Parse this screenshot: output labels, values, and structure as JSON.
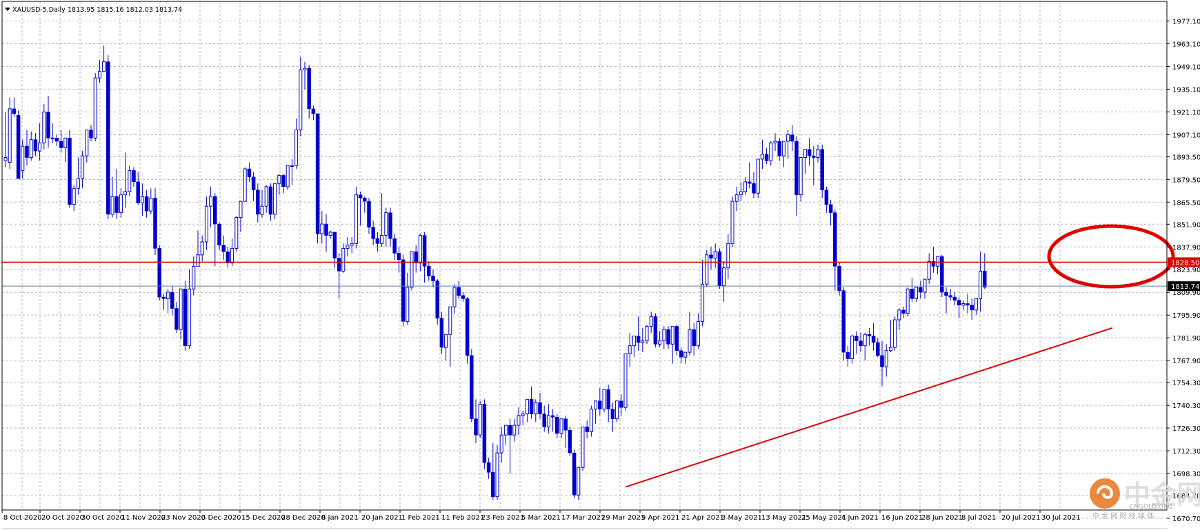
{
  "header": {
    "symbol": "XAUUSD-5,Daily",
    "ohlc": "1813.95 1815.16 1812.03 1813.74"
  },
  "price_labels": {
    "resistance": "1828.50",
    "current": "1813.74"
  },
  "watermark": {
    "brand": "中金网",
    "site": "CNGOLD.ORG",
    "tagline": "中 金 网 财 经 媒 体"
  },
  "colors": {
    "candle": "#0000cc",
    "grid": "#b4b4b4",
    "resistance_line": "#e00000",
    "trend_line": "#e00000",
    "highlight_ellipse": "#e00000",
    "current_price_line": "#5a7fa8",
    "axis_label_resistance_bg": "#e00000",
    "axis_label_current_bg": "#000000",
    "watermark_logo": "#e8741c"
  },
  "chart_data": {
    "type": "candlestick",
    "title": "XAUUSD-5,Daily",
    "ylim": [
      1670.7,
      1984.1
    ],
    "y_ticks": [
      "1977.10",
      "1963.10",
      "1949.10",
      "1935.10",
      "1921.10",
      "1907.10",
      "1893.50",
      "1879.50",
      "1865.50",
      "1851.90",
      "1837.90",
      "1823.90",
      "1809.90",
      "1795.90",
      "1781.90",
      "1767.90",
      "1754.30",
      "1740.30",
      "1726.30",
      "1712.30",
      "1698.30",
      "1684.70",
      "1670.70"
    ],
    "x_labels": [
      "8 Oct 2020",
      "20 Oct 2020",
      "30 Oct 2020",
      "11 Nov 2020",
      "23 Nov 2020",
      "3 Dec 2020",
      "15 Dec 2020",
      "28 Dec 2020",
      "8 Jan 2021",
      "20 Jan 2021",
      "1 Feb 2021",
      "11 Feb 2021",
      "23 Feb 2021",
      "5 Mar 2021",
      "17 Mar 2021",
      "29 Mar 2021",
      "9 Apr 2021",
      "21 Apr 2021",
      "3 May 2021",
      "13 May 2021",
      "25 May 2021",
      "4 Jun 2021",
      "16 Jun 2021",
      "28 Jun 2021",
      "8 Jul 2021",
      "20 Jul 2021",
      "30 Jul 2021"
    ],
    "grid": true,
    "resistance_level": 1828.5,
    "current_price": 1813.74,
    "trend_line": {
      "from_index": 145,
      "from_price": 1690,
      "to_index": 254,
      "to_price": 1788
    },
    "highlight": "ellipse around recent highs near 1828.50",
    "candles": [
      [
        1891,
        1921,
        1893,
        1887
      ],
      [
        1890,
        1930,
        1923,
        1886
      ],
      [
        1923,
        1930,
        1920,
        1918
      ],
      [
        1919,
        1922,
        1880,
        1885
      ],
      [
        1885,
        1904,
        1900,
        1880
      ],
      [
        1900,
        1910,
        1893,
        1888
      ],
      [
        1893,
        1909,
        1904,
        1891
      ],
      [
        1904,
        1908,
        1897,
        1894
      ],
      [
        1897,
        1914,
        1902,
        1891
      ],
      [
        1902,
        1926,
        1921,
        1898
      ],
      [
        1921,
        1931,
        1905,
        1899
      ],
      [
        1905,
        1914,
        1905,
        1902
      ],
      [
        1905,
        1907,
        1903,
        1900
      ],
      [
        1903,
        1910,
        1899,
        1896
      ],
      [
        1899,
        1905,
        1905,
        1890
      ],
      [
        1905,
        1910,
        1864,
        1862
      ],
      [
        1864,
        1876,
        1874,
        1860
      ],
      [
        1874,
        1893,
        1880,
        1870
      ],
      [
        1880,
        1897,
        1894,
        1874
      ],
      [
        1894,
        1910,
        1910,
        1890
      ],
      [
        1910,
        1913,
        1905,
        1903
      ],
      [
        1905,
        1945,
        1942,
        1903
      ],
      [
        1942,
        1953,
        1946,
        1939
      ],
      [
        1946,
        1962,
        1952,
        1946
      ],
      [
        1952,
        1956,
        1858,
        1855
      ],
      [
        1858,
        1881,
        1869,
        1856
      ],
      [
        1869,
        1886,
        1859,
        1855
      ],
      [
        1859,
        1874,
        1870,
        1856
      ],
      [
        1870,
        1896,
        1872,
        1862
      ],
      [
        1872,
        1888,
        1885,
        1869
      ],
      [
        1885,
        1887,
        1878,
        1875
      ],
      [
        1878,
        1884,
        1865,
        1864
      ],
      [
        1865,
        1877,
        1869,
        1857
      ],
      [
        1869,
        1873,
        1860,
        1856
      ],
      [
        1860,
        1874,
        1868,
        1858
      ],
      [
        1868,
        1874,
        1837,
        1833
      ],
      [
        1837,
        1839,
        1807,
        1805
      ],
      [
        1807,
        1809,
        1806,
        1799
      ],
      [
        1806,
        1812,
        1810,
        1797
      ],
      [
        1810,
        1814,
        1800,
        1796
      ],
      [
        1800,
        1804,
        1787,
        1785
      ],
      [
        1787,
        1807,
        1812,
        1781
      ],
      [
        1812,
        1817,
        1777,
        1774
      ],
      [
        1777,
        1824,
        1812,
        1775
      ],
      [
        1812,
        1832,
        1826,
        1808
      ],
      [
        1826,
        1848,
        1833,
        1826
      ],
      [
        1833,
        1845,
        1841,
        1829
      ],
      [
        1841,
        1869,
        1863,
        1836
      ],
      [
        1863,
        1875,
        1869,
        1850
      ],
      [
        1869,
        1871,
        1852,
        1826
      ],
      [
        1852,
        1853,
        1839,
        1836
      ],
      [
        1839,
        1845,
        1835,
        1830
      ],
      [
        1835,
        1838,
        1828,
        1825
      ],
      [
        1828,
        1843,
        1837,
        1826
      ],
      [
        1837,
        1857,
        1856,
        1835
      ],
      [
        1856,
        1866,
        1866,
        1847
      ],
      [
        1866,
        1887,
        1886,
        1866
      ],
      [
        1886,
        1890,
        1881,
        1878
      ],
      [
        1881,
        1884,
        1873,
        1866
      ],
      [
        1873,
        1877,
        1858,
        1853
      ],
      [
        1858,
        1873,
        1863,
        1856
      ],
      [
        1863,
        1876,
        1875,
        1859
      ],
      [
        1875,
        1877,
        1858,
        1854
      ],
      [
        1858,
        1870,
        1877,
        1855
      ],
      [
        1877,
        1883,
        1882,
        1870
      ],
      [
        1882,
        1883,
        1875,
        1871
      ],
      [
        1875,
        1884,
        1888,
        1873
      ],
      [
        1888,
        1892,
        1888,
        1876
      ],
      [
        1888,
        1917,
        1910,
        1886
      ],
      [
        1910,
        1955,
        1947,
        1906
      ],
      [
        1947,
        1952,
        1948,
        1935
      ],
      [
        1948,
        1950,
        1923,
        1917
      ],
      [
        1923,
        1925,
        1920,
        1916
      ],
      [
        1920,
        1920,
        1846,
        1840
      ],
      [
        1846,
        1860,
        1852,
        1840
      ],
      [
        1852,
        1858,
        1845,
        1835
      ],
      [
        1845,
        1848,
        1847,
        1843
      ],
      [
        1847,
        1847,
        1831,
        1825
      ],
      [
        1831,
        1834,
        1823,
        1806
      ],
      [
        1823,
        1840,
        1837,
        1822
      ],
      [
        1837,
        1844,
        1839,
        1832
      ],
      [
        1839,
        1844,
        1840,
        1834
      ],
      [
        1840,
        1875,
        1870,
        1837
      ],
      [
        1870,
        1872,
        1868,
        1851
      ],
      [
        1868,
        1869,
        1866,
        1859
      ],
      [
        1866,
        1868,
        1850,
        1846
      ],
      [
        1850,
        1854,
        1843,
        1839
      ],
      [
        1843,
        1847,
        1840,
        1835
      ],
      [
        1840,
        1871,
        1845,
        1838
      ],
      [
        1845,
        1862,
        1859,
        1838
      ],
      [
        1859,
        1862,
        1843,
        1838
      ],
      [
        1843,
        1846,
        1834,
        1830
      ],
      [
        1834,
        1838,
        1830,
        1822
      ],
      [
        1830,
        1833,
        1792,
        1789
      ],
      [
        1792,
        1822,
        1813,
        1790
      ],
      [
        1813,
        1832,
        1835,
        1811
      ],
      [
        1835,
        1839,
        1828,
        1822
      ],
      [
        1828,
        1846,
        1845,
        1823
      ],
      [
        1845,
        1847,
        1826,
        1816
      ],
      [
        1826,
        1829,
        1820,
        1817
      ],
      [
        1820,
        1824,
        1817,
        1813
      ],
      [
        1817,
        1818,
        1794,
        1790
      ],
      [
        1794,
        1798,
        1776,
        1772
      ],
      [
        1776,
        1780,
        1784,
        1768
      ],
      [
        1784,
        1792,
        1801,
        1764
      ],
      [
        1801,
        1815,
        1813,
        1797
      ],
      [
        1813,
        1817,
        1808,
        1806
      ],
      [
        1808,
        1810,
        1806,
        1804
      ],
      [
        1806,
        1807,
        1771,
        1766
      ],
      [
        1771,
        1775,
        1732,
        1730
      ],
      [
        1732,
        1744,
        1722,
        1717
      ],
      [
        1722,
        1743,
        1741,
        1720
      ],
      [
        1741,
        1744,
        1705,
        1701
      ],
      [
        1705,
        1708,
        1699,
        1695
      ],
      [
        1699,
        1717,
        1684,
        1682
      ],
      [
        1684,
        1716,
        1711,
        1682
      ],
      [
        1711,
        1727,
        1722,
        1705
      ],
      [
        1722,
        1725,
        1728,
        1716
      ],
      [
        1728,
        1732,
        1722,
        1698
      ],
      [
        1722,
        1732,
        1728,
        1718
      ],
      [
        1728,
        1739,
        1734,
        1722
      ],
      [
        1734,
        1737,
        1735,
        1728
      ],
      [
        1735,
        1744,
        1744,
        1730
      ],
      [
        1744,
        1752,
        1735,
        1732
      ],
      [
        1735,
        1744,
        1742,
        1730
      ],
      [
        1742,
        1748,
        1735,
        1732
      ],
      [
        1735,
        1740,
        1727,
        1724
      ],
      [
        1727,
        1741,
        1734,
        1723
      ],
      [
        1734,
        1738,
        1733,
        1724
      ],
      [
        1733,
        1735,
        1723,
        1720
      ],
      [
        1723,
        1725,
        1732,
        1720
      ],
      [
        1732,
        1734,
        1725,
        1714
      ],
      [
        1725,
        1727,
        1711,
        1709
      ],
      [
        1711,
        1713,
        1685,
        1683
      ],
      [
        1685,
        1696,
        1702,
        1682
      ],
      [
        1702,
        1717,
        1727,
        1700
      ],
      [
        1727,
        1731,
        1724,
        1720
      ],
      [
        1724,
        1740,
        1738,
        1721
      ],
      [
        1738,
        1739,
        1743,
        1729
      ],
      [
        1743,
        1751,
        1738,
        1734
      ],
      [
        1738,
        1749,
        1750,
        1736
      ],
      [
        1750,
        1753,
        1738,
        1730
      ],
      [
        1738,
        1742,
        1732,
        1724
      ],
      [
        1732,
        1736,
        1743,
        1730
      ],
      [
        1743,
        1747,
        1739,
        1734
      ],
      [
        1739,
        1771,
        1772,
        1737
      ],
      [
        1772,
        1785,
        1777,
        1764
      ],
      [
        1777,
        1783,
        1783,
        1770
      ],
      [
        1783,
        1795,
        1779,
        1774
      ],
      [
        1779,
        1788,
        1780,
        1773
      ],
      [
        1780,
        1790,
        1789,
        1778
      ],
      [
        1789,
        1798,
        1795,
        1785
      ],
      [
        1795,
        1797,
        1778,
        1776
      ],
      [
        1778,
        1786,
        1780,
        1776
      ],
      [
        1780,
        1789,
        1787,
        1775
      ],
      [
        1787,
        1789,
        1778,
        1775
      ],
      [
        1778,
        1782,
        1789,
        1766
      ],
      [
        1789,
        1790,
        1774,
        1771
      ],
      [
        1774,
        1776,
        1770,
        1766
      ],
      [
        1770,
        1771,
        1773,
        1766
      ],
      [
        1773,
        1798,
        1787,
        1771
      ],
      [
        1787,
        1791,
        1777,
        1771
      ],
      [
        1777,
        1797,
        1792,
        1775
      ],
      [
        1792,
        1830,
        1815,
        1789
      ],
      [
        1815,
        1836,
        1833,
        1813
      ],
      [
        1833,
        1838,
        1831,
        1824
      ],
      [
        1831,
        1840,
        1835,
        1825
      ],
      [
        1835,
        1837,
        1814,
        1812
      ],
      [
        1814,
        1829,
        1825,
        1804
      ],
      [
        1825,
        1846,
        1840,
        1818
      ],
      [
        1840,
        1869,
        1866,
        1838
      ],
      [
        1866,
        1875,
        1870,
        1860
      ],
      [
        1870,
        1878,
        1872,
        1866
      ],
      [
        1872,
        1881,
        1878,
        1870
      ],
      [
        1878,
        1890,
        1877,
        1874
      ],
      [
        1877,
        1884,
        1871,
        1868
      ],
      [
        1871,
        1891,
        1892,
        1868
      ],
      [
        1892,
        1904,
        1895,
        1886
      ],
      [
        1895,
        1899,
        1891,
        1889
      ],
      [
        1891,
        1903,
        1902,
        1888
      ],
      [
        1902,
        1908,
        1903,
        1897
      ],
      [
        1903,
        1905,
        1894,
        1891
      ],
      [
        1894,
        1898,
        1903,
        1887
      ],
      [
        1903,
        1910,
        1907,
        1892
      ],
      [
        1907,
        1913,
        1903,
        1897
      ],
      [
        1903,
        1906,
        1870,
        1857
      ],
      [
        1870,
        1876,
        1893,
        1866
      ],
      [
        1893,
        1897,
        1898,
        1883
      ],
      [
        1898,
        1905,
        1894,
        1888
      ],
      [
        1894,
        1900,
        1893,
        1876
      ],
      [
        1893,
        1901,
        1898,
        1890
      ],
      [
        1898,
        1901,
        1873,
        1868
      ],
      [
        1873,
        1875,
        1864,
        1859
      ],
      [
        1864,
        1867,
        1859,
        1851
      ],
      [
        1859,
        1861,
        1826,
        1811
      ],
      [
        1826,
        1828,
        1811,
        1808
      ],
      [
        1811,
        1813,
        1773,
        1768
      ],
      [
        1773,
        1777,
        1769,
        1764
      ],
      [
        1769,
        1784,
        1783,
        1766
      ],
      [
        1783,
        1786,
        1780,
        1772
      ],
      [
        1780,
        1785,
        1777,
        1773
      ],
      [
        1777,
        1785,
        1784,
        1768
      ],
      [
        1784,
        1788,
        1783,
        1777
      ],
      [
        1783,
        1791,
        1779,
        1774
      ],
      [
        1779,
        1782,
        1771,
        1770
      ],
      [
        1771,
        1780,
        1764,
        1752
      ],
      [
        1764,
        1778,
        1774,
        1758
      ],
      [
        1774,
        1793,
        1776,
        1773
      ],
      [
        1776,
        1795,
        1793,
        1774
      ],
      [
        1793,
        1800,
        1799,
        1787
      ],
      [
        1799,
        1801,
        1797,
        1794
      ],
      [
        1797,
        1813,
        1812,
        1795
      ],
      [
        1812,
        1819,
        1806,
        1804
      ],
      [
        1806,
        1809,
        1813,
        1804
      ],
      [
        1813,
        1817,
        1810,
        1806
      ],
      [
        1810,
        1818,
        1818,
        1806
      ],
      [
        1818,
        1834,
        1829,
        1815
      ],
      [
        1829,
        1838,
        1826,
        1822
      ],
      [
        1826,
        1832,
        1832,
        1821
      ],
      [
        1832,
        1833,
        1810,
        1807
      ],
      [
        1810,
        1813,
        1808,
        1797
      ],
      [
        1808,
        1812,
        1807,
        1805
      ],
      [
        1807,
        1810,
        1805,
        1802
      ],
      [
        1805,
        1807,
        1802,
        1794
      ],
      [
        1802,
        1805,
        1803,
        1799
      ],
      [
        1803,
        1809,
        1802,
        1797
      ],
      [
        1802,
        1806,
        1799,
        1793
      ],
      [
        1799,
        1805,
        1806,
        1796
      ],
      [
        1806,
        1835,
        1823,
        1798
      ],
      [
        1823,
        1834,
        1813,
        1812
      ]
    ]
  }
}
